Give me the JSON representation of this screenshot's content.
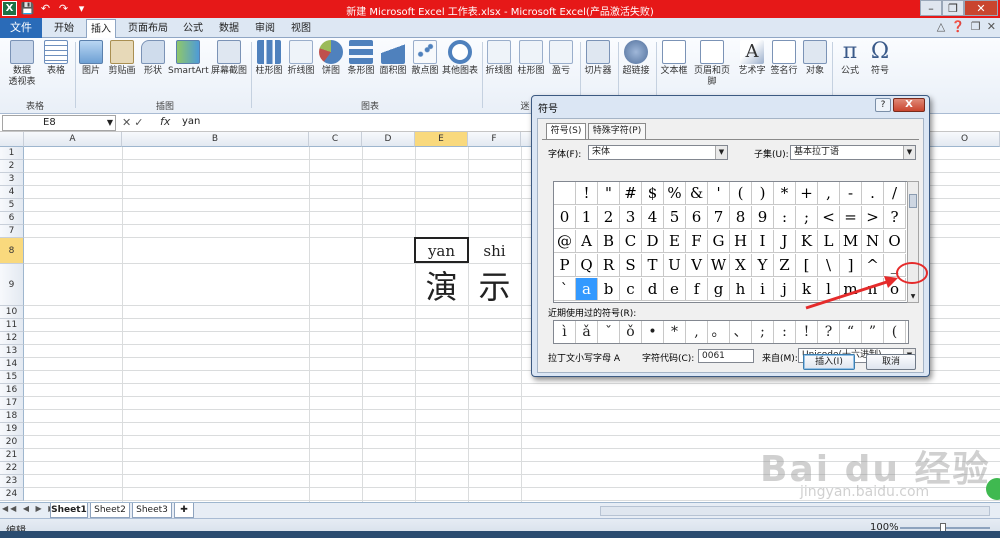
{
  "titlebar": {
    "title": "新建 Microsoft Excel 工作表.xlsx - Microsoft Excel(产品激活失败)",
    "qa_icons": [
      "excel-icon",
      "save-icon",
      "undo-icon",
      "redo-icon",
      "customize-icon"
    ]
  },
  "tabs": {
    "file": "文件",
    "items": [
      "开始",
      "插入",
      "页面布局",
      "公式",
      "数据",
      "审阅",
      "视图"
    ],
    "active": "插入"
  },
  "ribbon": {
    "buttons": [
      {
        "label": "数据\n透视表",
        "icon": "pivot-table-icon"
      },
      {
        "label": "表格",
        "icon": "table-icon"
      },
      {
        "label": "图片",
        "icon": "picture-icon"
      },
      {
        "label": "剪贴画",
        "icon": "clipart-icon"
      },
      {
        "label": "形状",
        "icon": "shapes-icon"
      },
      {
        "label": "SmartArt",
        "icon": "smartart-icon"
      },
      {
        "label": "屏幕截图",
        "icon": "screenshot-icon"
      },
      {
        "label": "柱形图",
        "icon": "column-chart-icon"
      },
      {
        "label": "折线图",
        "icon": "line-chart-icon"
      },
      {
        "label": "饼图",
        "icon": "pie-chart-icon"
      },
      {
        "label": "条形图",
        "icon": "bar-chart-icon"
      },
      {
        "label": "面积图",
        "icon": "area-chart-icon"
      },
      {
        "label": "散点图",
        "icon": "scatter-chart-icon"
      },
      {
        "label": "其他图表",
        "icon": "other-chart-icon"
      },
      {
        "label": "折线图",
        "icon": "sparkline-line-icon"
      },
      {
        "label": "柱形图",
        "icon": "sparkline-column-icon"
      },
      {
        "label": "盈亏",
        "icon": "sparkline-winloss-icon"
      },
      {
        "label": "切片器",
        "icon": "slicer-icon"
      },
      {
        "label": "超链接",
        "icon": "hyperlink-icon"
      },
      {
        "label": "文本框",
        "icon": "textbox-icon"
      },
      {
        "label": "页眉和页脚",
        "icon": "header-footer-icon"
      },
      {
        "label": "艺术字",
        "icon": "wordart-icon"
      },
      {
        "label": "签名行",
        "icon": "signature-icon"
      },
      {
        "label": "对象",
        "icon": "object-icon"
      },
      {
        "label": "公式",
        "icon": "equation-icon"
      },
      {
        "label": "符号",
        "icon": "symbol-icon"
      }
    ],
    "groups": [
      "表格",
      "插图",
      "图表",
      "迷"
    ]
  },
  "formula_bar": {
    "name_box": "E8",
    "fx": "fx",
    "value": "yan"
  },
  "grid": {
    "columns": [
      "A",
      "B",
      "C",
      "D",
      "E",
      "F",
      "O"
    ],
    "selected_column": "E",
    "rows": [
      "1",
      "2",
      "3",
      "4",
      "5",
      "6",
      "7",
      "8",
      "9",
      "10",
      "11",
      "12",
      "13",
      "14",
      "15",
      "16",
      "17",
      "18",
      "19",
      "20",
      "21",
      "22",
      "23",
      "24"
    ],
    "selected_row": "8",
    "cells": {
      "E8": "yan",
      "F8": "shi",
      "E9": "演",
      "F9": "示"
    }
  },
  "sheets": {
    "tabs": [
      "Sheet1",
      "Sheet2",
      "Sheet3"
    ],
    "active": "Sheet1"
  },
  "status": {
    "mode": "编辑",
    "zoom": "100%"
  },
  "dialog": {
    "title": "符号",
    "help": "?",
    "close": "X",
    "tabs": [
      "符号(S)",
      "特殊字符(P)"
    ],
    "font_label": "字体(F):",
    "font_value": "宋体",
    "subset_label": "子集(U):",
    "subset_value": "基本拉丁语",
    "symbols": [
      [
        " ",
        "!",
        "\"",
        "#",
        "$",
        "%",
        "&",
        "'",
        "(",
        ")",
        "*",
        "+",
        ",",
        "-",
        ".",
        "/"
      ],
      [
        "0",
        "1",
        "2",
        "3",
        "4",
        "5",
        "6",
        "7",
        "8",
        "9",
        ":",
        ";",
        "<",
        "=",
        ">",
        "?"
      ],
      [
        "@",
        "A",
        "B",
        "C",
        "D",
        "E",
        "F",
        "G",
        "H",
        "I",
        "J",
        "K",
        "L",
        "M",
        "N",
        "O"
      ],
      [
        "P",
        "Q",
        "R",
        "S",
        "T",
        "U",
        "V",
        "W",
        "X",
        "Y",
        "Z",
        "[",
        "\\",
        "]",
        "^",
        "_"
      ],
      [
        "`",
        "a",
        "b",
        "c",
        "d",
        "e",
        "f",
        "g",
        "h",
        "i",
        "j",
        "k",
        "l",
        "m",
        "n",
        "o"
      ]
    ],
    "selected_symbol": "a",
    "recent_label": "近期使用过的符号(R):",
    "recent": [
      "ì",
      "ǎ",
      "ˇ",
      "ǒ",
      "•",
      "*",
      ",",
      "。",
      "、",
      ";",
      ":",
      "!",
      "?",
      "“",
      "”",
      "("
    ],
    "char_name": "拉丁文小写字母 A",
    "char_code_label": "字符代码(C):",
    "char_code": "0061",
    "from_label": "来自(M):",
    "from_value": "Unicode(十六进制)",
    "insert_button": "插入(I)",
    "cancel_button": "取消"
  },
  "annotations": {
    "color": "#e52b2b"
  },
  "watermark": {
    "brand": "Bai du 经验",
    "url": "jingyan.baidu.com"
  },
  "colors": {
    "titlebar": "#e61818",
    "file_tab": "#2a6bb8",
    "selected_symbol": "#3399ff"
  }
}
